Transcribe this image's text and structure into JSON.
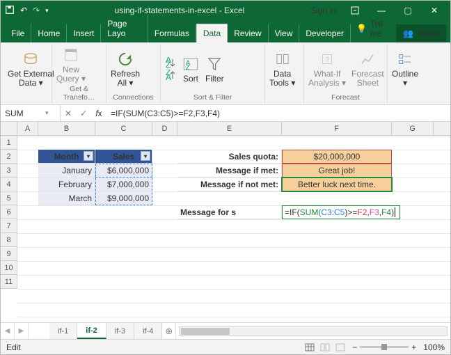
{
  "title": "using-if-statements-in-excel - Excel",
  "signin": "Sign in",
  "menu": {
    "file": "File",
    "home": "Home",
    "insert": "Insert",
    "layout": "Page Layo",
    "formulas": "Formulas",
    "data": "Data",
    "review": "Review",
    "view": "View",
    "developer": "Developer",
    "tell": "Tell me",
    "share": "Share"
  },
  "ribbon": {
    "getdata": "Get External\nData ▾",
    "newquery": "New\nQuery ▾",
    "refresh": "Refresh\nAll ▾",
    "sortAZ": "A→Z",
    "sortZA": "Z→A",
    "sortBig": "Sort",
    "filter": "Filter",
    "datatools": "Data\nTools ▾",
    "whatif": "What-If\nAnalysis ▾",
    "forecast": "Forecast\nSheet",
    "outline": "Outline\n▾",
    "g1": "Get & Transfo…",
    "g2": "Connections",
    "g3": "Sort & Filter",
    "g4": "Forecast"
  },
  "namebox": "SUM",
  "formula": "=IF(SUM(C3:C5)>=F2,F3,F4)",
  "cols": [
    "A",
    "B",
    "C",
    "D",
    "E",
    "F",
    "G"
  ],
  "rows": [
    "1",
    "2",
    "3",
    "4",
    "5",
    "6",
    "7",
    "8",
    "9",
    "10",
    "11"
  ],
  "table": {
    "hMonth": "Month",
    "hSales": "Sales",
    "r1m": "January",
    "r1s": "$6,000,000",
    "r2m": "February",
    "r2s": "$7,000,000",
    "r3m": "March",
    "r3s": "$9,000,000"
  },
  "labels": {
    "quota": "Sales quota:",
    "met": "Message if met:",
    "notmet": "Message if not met:",
    "msg": "Message for s"
  },
  "vals": {
    "quota": "$20,000,000",
    "met": "Great job!",
    "notmet": "Better luck next time."
  },
  "editformula": {
    "pre": "=IF(",
    "sum": "SUM(",
    "range": "C3:C5",
    "close": ")>=",
    "f2": "F2",
    ",a": ",",
    "f3": "F3",
    ",b": ",",
    "f4": "F4",
    "end": ")"
  },
  "tabs": [
    "if-1",
    "if-2",
    "if-3",
    "if-4"
  ],
  "activeTab": "if-2",
  "plus": "⊕",
  "status": "Edit",
  "zoom": "100%"
}
